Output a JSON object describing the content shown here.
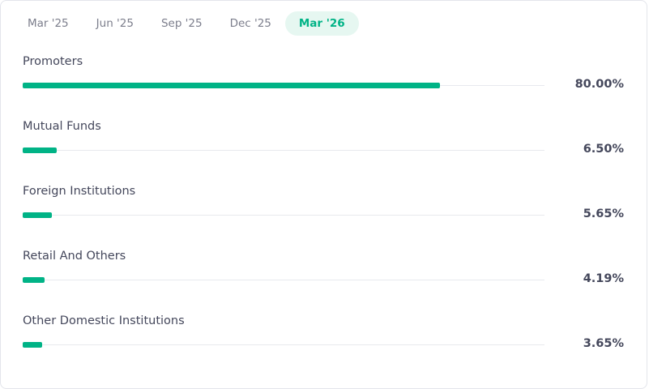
{
  "tabs": [
    {
      "label": "Mar '25",
      "active": false
    },
    {
      "label": "Jun '25",
      "active": false
    },
    {
      "label": "Sep '25",
      "active": false
    },
    {
      "label": "Dec '25",
      "active": false
    },
    {
      "label": "Mar '26",
      "active": true
    }
  ],
  "holdings": [
    {
      "label": "Promoters",
      "value_text": "80.00%",
      "fill_fraction": 0.8
    },
    {
      "label": "Mutual Funds",
      "value_text": "6.50%",
      "fill_fraction": 0.065
    },
    {
      "label": "Foreign Institutions",
      "value_text": "5.65%",
      "fill_fraction": 0.0565
    },
    {
      "label": "Retail And Others",
      "value_text": "4.19%",
      "fill_fraction": 0.0419
    },
    {
      "label": "Other Domestic Institutions",
      "value_text": "3.65%",
      "fill_fraction": 0.0365
    }
  ],
  "colors": {
    "accent": "#00b386",
    "accent_bg": "#e6f7f1",
    "track": "#e8e9ee",
    "text": "#44475b",
    "muted_text": "#7c7e8c"
  }
}
